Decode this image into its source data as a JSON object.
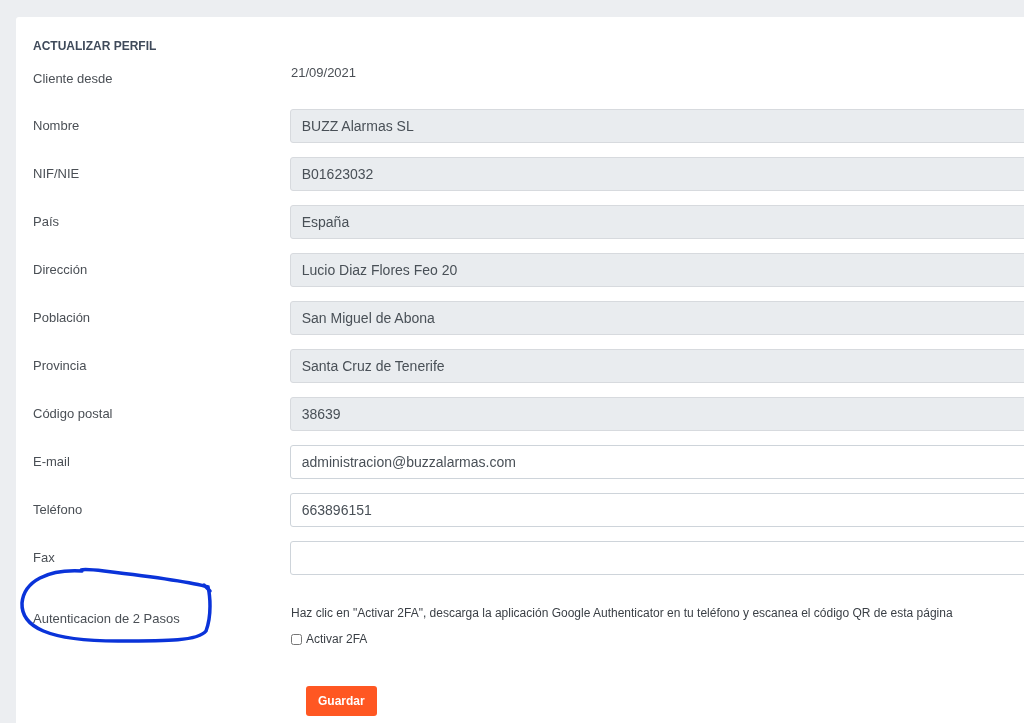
{
  "title": "ACTUALIZAR PERFIL",
  "since": {
    "label": "Cliente desde",
    "value": "21/09/2021"
  },
  "fields": [
    {
      "label": "Nombre",
      "value": "BUZZ Alarmas SL",
      "disabled": true
    },
    {
      "label": "NIF/NIE",
      "value": "B01623032",
      "disabled": true
    },
    {
      "label": "País",
      "value": "España",
      "disabled": true
    },
    {
      "label": "Dirección",
      "value": "Lucio Diaz Flores Feo 20",
      "disabled": true
    },
    {
      "label": "Población",
      "value": "San Miguel de Abona",
      "disabled": true
    },
    {
      "label": "Provincia",
      "value": "Santa Cruz de Tenerife",
      "disabled": true
    },
    {
      "label": "Código postal",
      "value": "38639",
      "disabled": true
    },
    {
      "label": "E-mail",
      "value": "administracion@buzzalarmas.com",
      "disabled": false
    },
    {
      "label": "Teléfono",
      "value": "663896151",
      "disabled": false
    },
    {
      "label": "Fax",
      "disabled": false
    }
  ],
  "two_factor": {
    "label": "Autenticacion de 2 Pasos",
    "hint": "Haz clic en \"Activar 2FA\", descarga la aplicación Google Authenticator en tu teléfono y escanea el código QR de esta página",
    "checkbox": {
      "label": "Activar 2FA",
      "checked": false
    }
  },
  "save_button": "Guardar"
}
